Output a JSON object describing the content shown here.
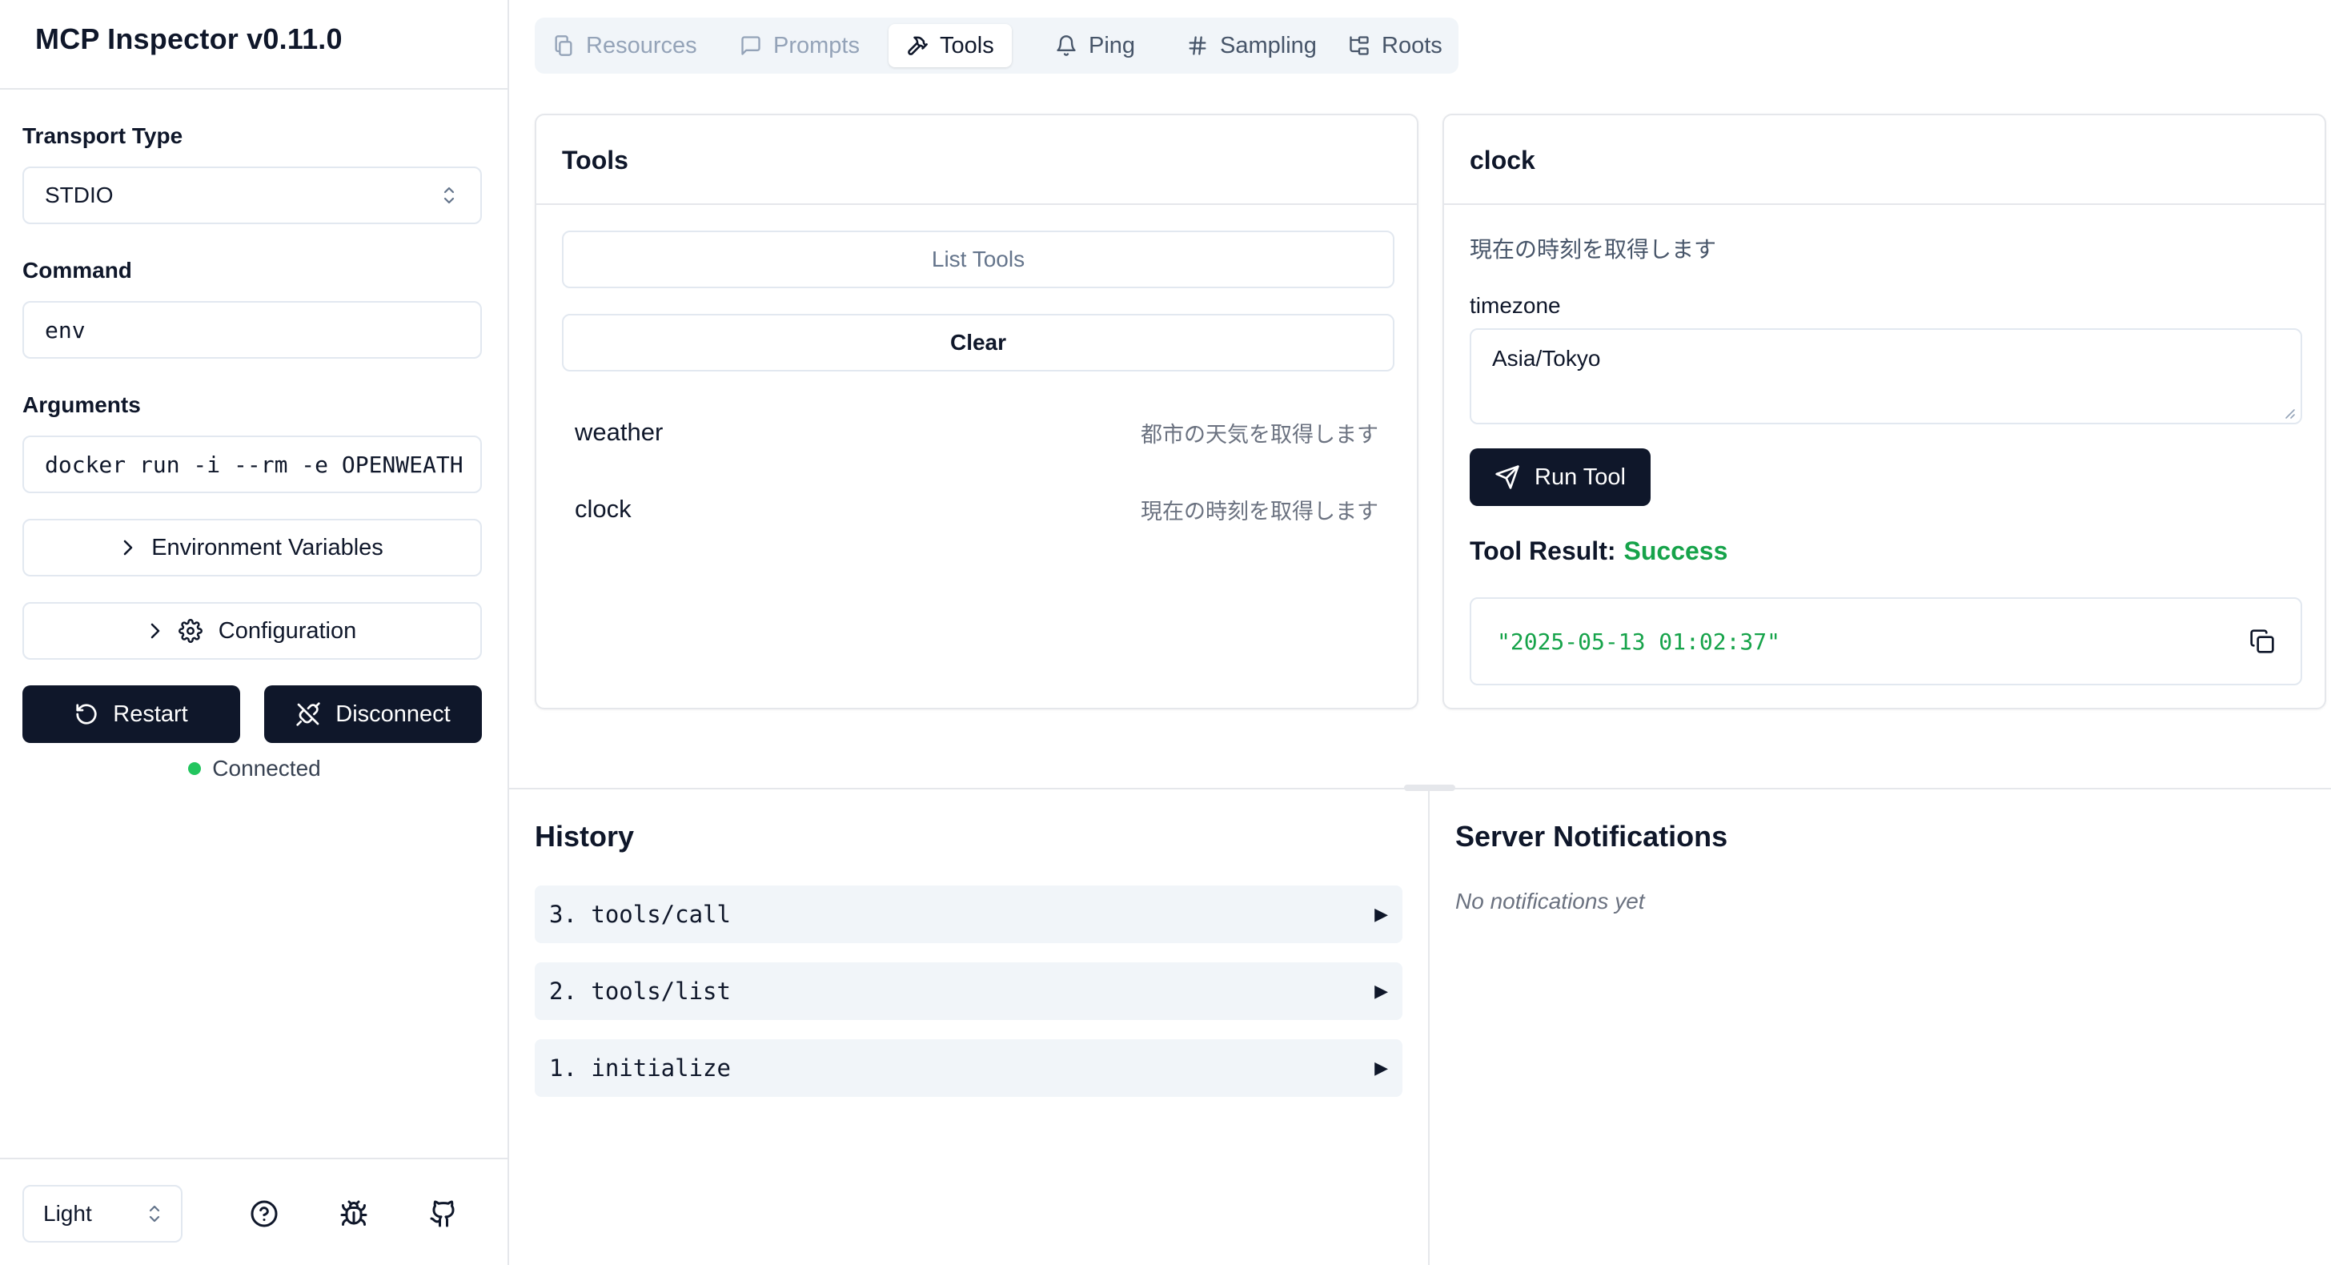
{
  "app": {
    "title": "MCP Inspector v0.11.0"
  },
  "sidebar": {
    "transport_label": "Transport Type",
    "transport_value": "STDIO",
    "command_label": "Command",
    "command_value": "env",
    "arguments_label": "Arguments",
    "arguments_value": "docker run -i --rm -e OPENWEATH",
    "env_vars_label": "Environment Variables",
    "config_label": "Configuration",
    "restart_label": "Restart",
    "disconnect_label": "Disconnect",
    "status_text": "Connected",
    "status_color": "#22c55e",
    "theme_value": "Light"
  },
  "tabs": [
    {
      "label": "Resources",
      "icon": "files-icon"
    },
    {
      "label": "Prompts",
      "icon": "message-icon"
    },
    {
      "label": "Tools",
      "icon": "hammer-icon",
      "active": true
    },
    {
      "label": "Ping",
      "icon": "bell-icon"
    },
    {
      "label": "Sampling",
      "icon": "hash-icon"
    },
    {
      "label": "Roots",
      "icon": "folder-tree-icon"
    }
  ],
  "tools_panel": {
    "title": "Tools",
    "list_button": "List Tools",
    "clear_button": "Clear",
    "items": [
      {
        "name": "weather",
        "description": "都市の天気を取得します"
      },
      {
        "name": "clock",
        "description": "現在の時刻を取得します"
      }
    ]
  },
  "detail_panel": {
    "title": "clock",
    "description": "現在の時刻を取得します",
    "param_label": "timezone",
    "param_value": "Asia/Tokyo",
    "run_button": "Run Tool",
    "result_label": "Tool Result:",
    "result_status": "Success",
    "result_status_color": "#16a34a",
    "result_value": "\"2025-05-13 01:02:37\""
  },
  "history": {
    "title": "History",
    "items": [
      {
        "label": "3. tools/call"
      },
      {
        "label": "2. tools/list"
      },
      {
        "label": "1. initialize"
      }
    ],
    "expand_glyph": "▶"
  },
  "notifications": {
    "title": "Server Notifications",
    "empty_text": "No notifications yet"
  }
}
